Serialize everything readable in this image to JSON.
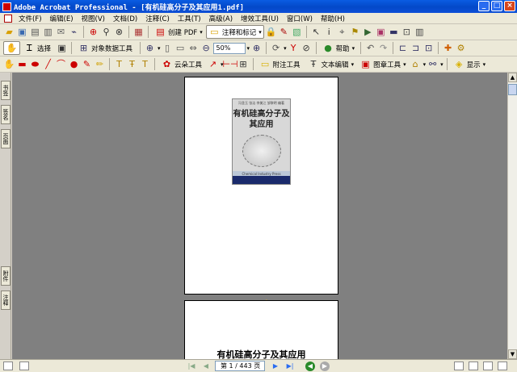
{
  "window": {
    "title": "Adobe Acrobat Professional - [有机硅高分子及其应用1.pdf]",
    "minimize": "_",
    "maximize": "□",
    "close": "×"
  },
  "menu": [
    "文件(F)",
    "编辑(E)",
    "视图(V)",
    "文档(D)",
    "注释(C)",
    "工具(T)",
    "高级(A)",
    "增效工具(U)",
    "窗口(W)",
    "帮助(H)"
  ],
  "toolbar1": {
    "create_pdf": "创建 PDF",
    "comment_markup": "注释和标记",
    "dropdown": "▾"
  },
  "toolbar2": {
    "select": "选择",
    "object_data": "对象数据工具",
    "zoom": "50%",
    "help": "帮助"
  },
  "toolbar3": {
    "cloud_tool": "云朵工具",
    "attach_tool": "附注工具",
    "text_edit": "文本编辑",
    "stamp_tool": "图章工具",
    "show": "显示"
  },
  "sidepanel": {
    "tabs_top": [
      "书签",
      "签名",
      "页面"
    ],
    "tabs_bottom": [
      "附件",
      "注释"
    ]
  },
  "document": {
    "cover_title": "有机硅高分子及其应用",
    "cover_authors": "冯圣玉 张洁 李美江 邹黎明 编著",
    "cover_band": "Chemical Industry Press",
    "page2_title": "有机硅高分子及其应用",
    "hand_cursor": "✋"
  },
  "statusbar": {
    "page_indicator": "第 1 / 443 页",
    "first": "|◀",
    "prev": "◀",
    "next": "▶",
    "last": "▶|"
  },
  "colors": {
    "titlebar": "#0a5ce2",
    "document_bg": "#808080",
    "chrome": "#ece9d8"
  }
}
